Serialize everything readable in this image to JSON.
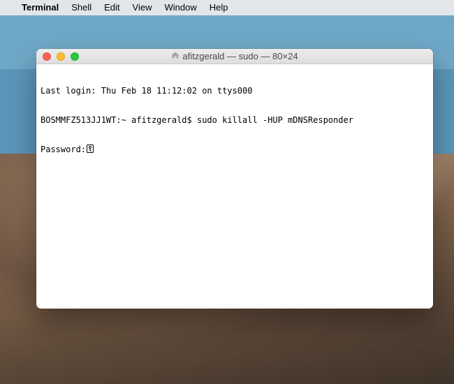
{
  "menubar": {
    "apple": "",
    "app": "Terminal",
    "items": [
      "Shell",
      "Edit",
      "View",
      "Window",
      "Help"
    ]
  },
  "window": {
    "title": "afitzgerald — sudo — 80×24"
  },
  "terminal": {
    "line1": "Last login: Thu Feb 18 11:12:02 on ttys000",
    "line2_prompt": "BOSMMFZ513JJ1WT:~ afitzgerald$ ",
    "line2_cmd": "sudo killall -HUP mDNSResponder",
    "line3": "Password:"
  }
}
